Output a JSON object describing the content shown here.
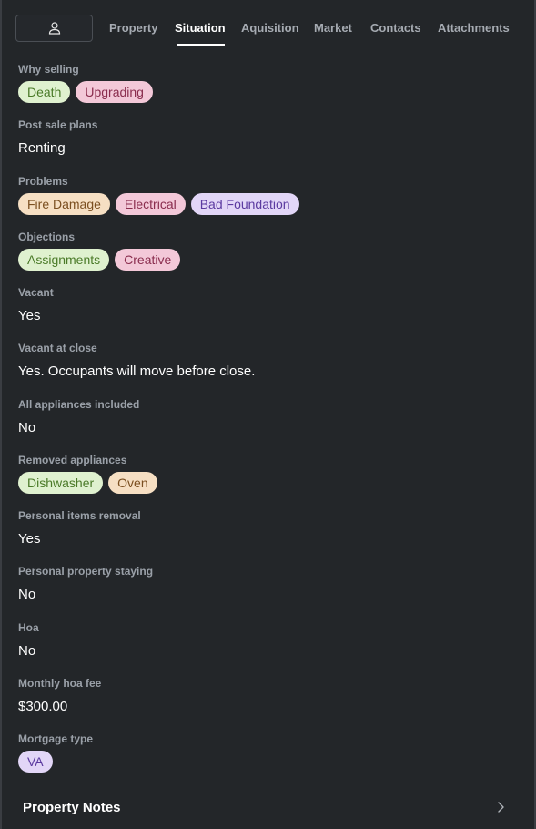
{
  "tabs": {
    "profile_icon": "person-icon",
    "items": [
      "Property",
      "Situation",
      "Aquisition",
      "Market",
      "Contacts",
      "Attachments"
    ],
    "active": "Situation"
  },
  "fields": {
    "why_selling": {
      "label": "Why selling",
      "chips": [
        "Death",
        "Upgrading"
      ]
    },
    "post_sale_plans": {
      "label": "Post sale plans",
      "value": "Renting"
    },
    "problems": {
      "label": "Problems",
      "chips": [
        "Fire Damage",
        "Electrical",
        "Bad Foundation"
      ]
    },
    "objections": {
      "label": "Objections",
      "chips": [
        "Assignments",
        "Creative"
      ]
    },
    "vacant": {
      "label": "Vacant",
      "value": "Yes"
    },
    "vacant_at_close": {
      "label": "Vacant at close",
      "value": "Yes. Occupants will move before close."
    },
    "all_appliances": {
      "label": "All appliances included",
      "value": "No"
    },
    "removed_appliances": {
      "label": "Removed appliances",
      "chips": [
        "Dishwasher",
        "Oven"
      ]
    },
    "personal_items_removal": {
      "label": "Personal items removal",
      "value": "Yes"
    },
    "personal_property_staying": {
      "label": "Personal property staying",
      "value": "No"
    },
    "hoa": {
      "label": "Hoa",
      "value": "No"
    },
    "monthly_hoa_fee": {
      "label": "Monthly hoa fee",
      "value": "$300.00"
    },
    "mortgage_type": {
      "label": "Mortgage type",
      "chips": [
        "VA"
      ]
    }
  },
  "notes": {
    "title": "Property Notes",
    "icon": "chevron-right-icon"
  },
  "colors": {
    "background": "#232629",
    "chip_green": "#dff1cf",
    "chip_pink": "#f3c8d8",
    "chip_orange": "#f6dfc3",
    "chip_purple": "#e2d6f7"
  }
}
